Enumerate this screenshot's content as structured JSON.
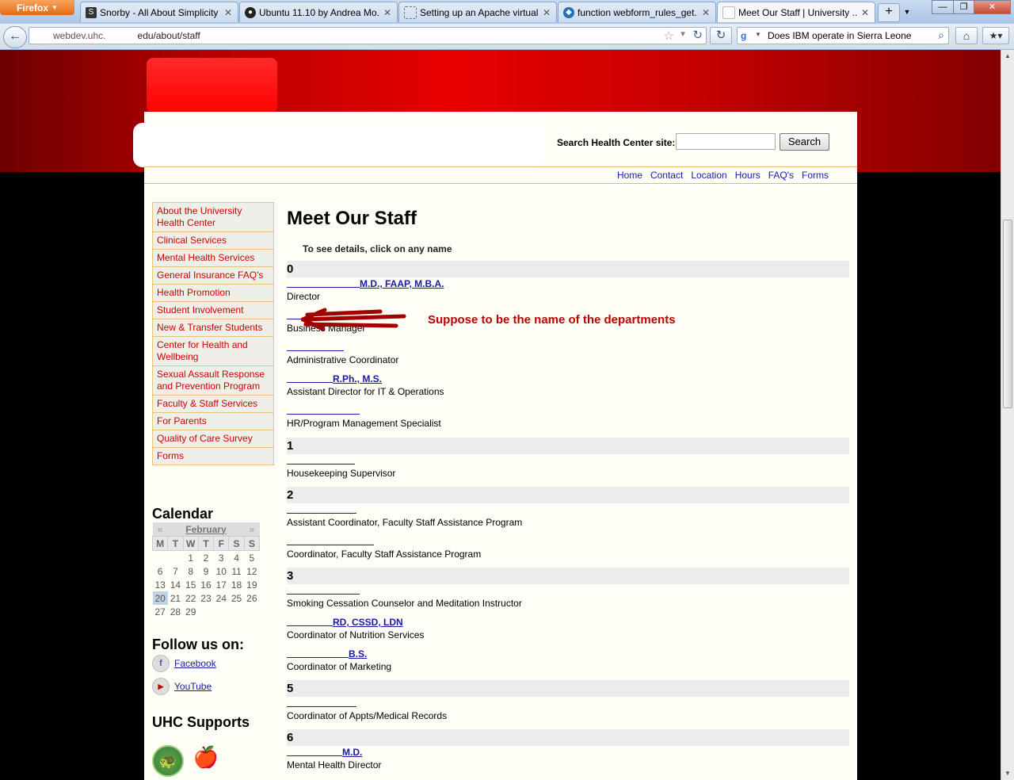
{
  "browser": {
    "firefox_button": "Firefox",
    "tabs": [
      {
        "label": "Snorby - All About Simplicity",
        "icon": "snorby-icon"
      },
      {
        "label": "Ubuntu 11.10 by Andrea Mo...",
        "icon": "github-icon"
      },
      {
        "label": "Setting up an Apache virtual...",
        "icon": "blank-page-icon"
      },
      {
        "label": "function webform_rules_get...",
        "icon": "drupal-icon"
      },
      {
        "label": "Meet Our Staff | University ...",
        "icon": "page-icon"
      }
    ],
    "url_prefix": "webdev.uhc.",
    "url_suffix": "edu/about/staff",
    "search_text": "Does IBM operate in Sierra Leone"
  },
  "header": {
    "search_label": "Search Health Center site:",
    "search_button": "Search",
    "nav": [
      "Home",
      "Contact",
      "Location",
      "Hours",
      "FAQ's",
      "Forms"
    ]
  },
  "sidebar": {
    "items": [
      "About the University Health Center",
      "Clinical Services",
      "Mental Health Services",
      "General Insurance FAQ's",
      "Health Promotion",
      "Student Involvement",
      "New & Transfer Students",
      "Center for Health and Wellbeing",
      "Sexual Assault Response and Prevention Program",
      "Faculty & Staff Services",
      "For Parents",
      "Quality of Care Survey",
      "Forms"
    ],
    "calendar_title": "Calendar",
    "calendar": {
      "prev": "«",
      "next": "»",
      "month": "February",
      "daynames": [
        "M",
        "T",
        "W",
        "T",
        "F",
        "S",
        "S"
      ],
      "weeks": [
        [
          "",
          "",
          "1",
          "2",
          "3",
          "4",
          "5"
        ],
        [
          "6",
          "7",
          "8",
          "9",
          "10",
          "11",
          "12"
        ],
        [
          "13",
          "14",
          "15",
          "16",
          "17",
          "18",
          "19"
        ],
        [
          "20",
          "21",
          "22",
          "23",
          "24",
          "25",
          "26"
        ],
        [
          "27",
          "28",
          "29",
          "",
          "",
          "",
          ""
        ]
      ],
      "today": "20"
    },
    "follow_title": "Follow us on:",
    "social": [
      "Facebook",
      "YouTube"
    ],
    "supports_title": "UHC Supports"
  },
  "main": {
    "title": "Meet Our Staff",
    "instructions": "To see details, click on any name",
    "annotation": "Suppose to be the name of the departments",
    "departments": [
      {
        "label": "0",
        "staff": [
          {
            "name": "M.D., FAAP, M.B.A.",
            "title": "Director"
          },
          {
            "name": "",
            "title": "Business Manager"
          },
          {
            "name": "",
            "title": "Administrative Coordinator"
          },
          {
            "name": "R.Ph., M.S.",
            "title": "Assistant Director for IT & Operations"
          },
          {
            "name": "",
            "title": "HR/Program Management Specialist"
          }
        ]
      },
      {
        "label": "1",
        "staff": [
          {
            "name": "",
            "title": "Housekeeping Supervisor"
          }
        ]
      },
      {
        "label": "2",
        "staff": [
          {
            "name": "",
            "title": "Assistant Coordinator, Faculty Staff Assistance Program"
          },
          {
            "name": "",
            "title": "Coordinator, Faculty Staff Assistance Program"
          }
        ]
      },
      {
        "label": "3",
        "staff": [
          {
            "name": "",
            "title": "Smoking Cessation Counselor and Meditation Instructor"
          },
          {
            "name": "RD, CSSD, LDN",
            "title": "Coordinator of Nutrition Services"
          },
          {
            "name": "B.S.",
            "title": "Coordinator of Marketing"
          }
        ]
      },
      {
        "label": "5",
        "staff": [
          {
            "name": "",
            "title": "Coordinator of Appts/Medical Records"
          }
        ]
      },
      {
        "label": "6",
        "staff": [
          {
            "name": "M.D.",
            "title": "Mental Health Director"
          }
        ]
      }
    ]
  },
  "colors": {
    "brand_red": "#cc0000",
    "link_blue": "#1a1aa8",
    "annotation_red": "#c00000"
  }
}
